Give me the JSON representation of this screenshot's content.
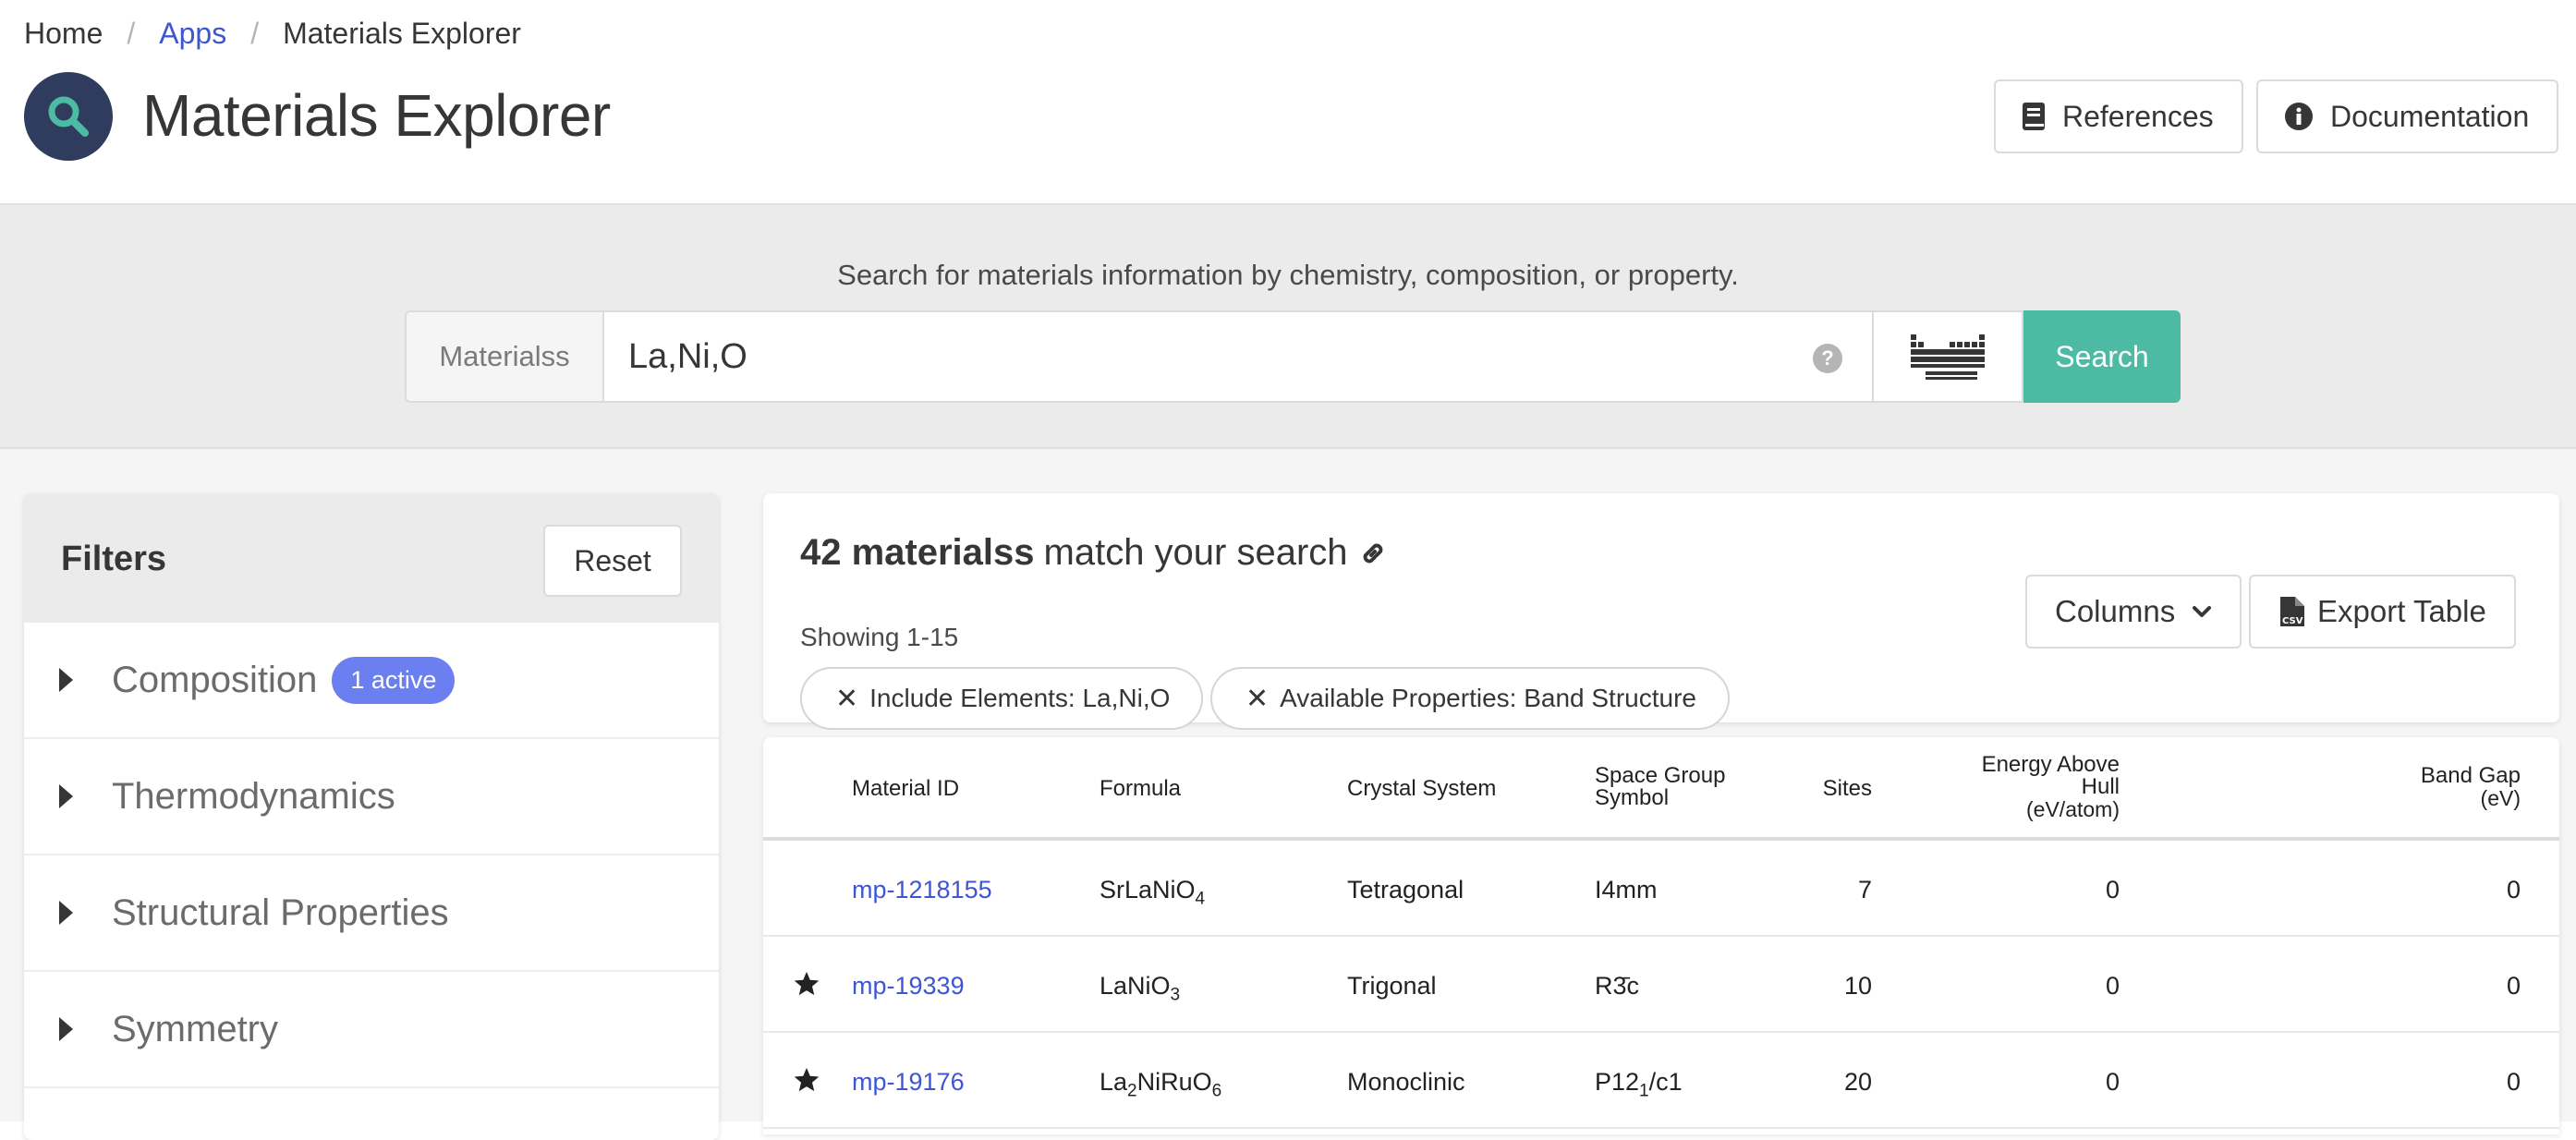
{
  "breadcrumb": {
    "home": "Home",
    "apps": "Apps",
    "current": "Materials Explorer",
    "separator": "/"
  },
  "header": {
    "title": "Materials Explorer",
    "references_label": "References",
    "documentation_label": "Documentation"
  },
  "search": {
    "tagline": "Search for materials information by chemistry, composition, or property.",
    "addon_label": "Materialss",
    "query_value": "La,Ni,O",
    "help_glyph": "?",
    "button_label": "Search"
  },
  "filters": {
    "title": "Filters",
    "reset_label": "Reset",
    "items": [
      {
        "label": "Composition",
        "badge": "1 active"
      },
      {
        "label": "Thermodynamics"
      },
      {
        "label": "Structural Properties"
      },
      {
        "label": "Symmetry"
      }
    ]
  },
  "results": {
    "count_bold": "42 materialss",
    "count_rest": "match your search",
    "showing": "Showing 1-15",
    "columns_label": "Columns",
    "export_label": "Export Table",
    "chips": [
      {
        "x": "✕",
        "label": "Include Elements: La,Ni,O"
      },
      {
        "x": "✕",
        "label": "Available Properties: Band Structure"
      }
    ]
  },
  "table": {
    "headers": {
      "material_id": "Material ID",
      "formula": "Formula",
      "crystal_system": "Crystal System",
      "space_group_1": "Space Group",
      "space_group_2": "Symbol",
      "sites": "Sites",
      "ehull_1": "Energy Above",
      "ehull_2": "Hull",
      "ehull_unit": "(eV/atom)",
      "bandgap": "Band Gap",
      "bandgap_unit": "(eV)"
    },
    "rows": [
      {
        "starred": false,
        "id": "mp-1218155",
        "crystal": "Tetragonal",
        "sites": "7",
        "ehull": "0",
        "gap": "0"
      },
      {
        "starred": true,
        "id": "mp-19339",
        "crystal": "Trigonal",
        "sites": "10",
        "ehull": "0",
        "gap": "0"
      },
      {
        "starred": true,
        "id": "mp-19176",
        "crystal": "Monoclinic",
        "sites": "20",
        "ehull": "0",
        "gap": "0"
      }
    ]
  },
  "icons": {
    "search": "search-icon",
    "book": "book-icon",
    "info": "info-icon",
    "periodic_table": "periodic-table-icon",
    "link": "link-icon",
    "chevron": "chevron-down-icon",
    "csv": "csv-file-icon",
    "star": "star-icon"
  },
  "colors": {
    "accent": "#4dbba4",
    "link": "#3e56d4",
    "badge": "#6c7ff0",
    "title_icon_bg": "#2f3c5e"
  }
}
